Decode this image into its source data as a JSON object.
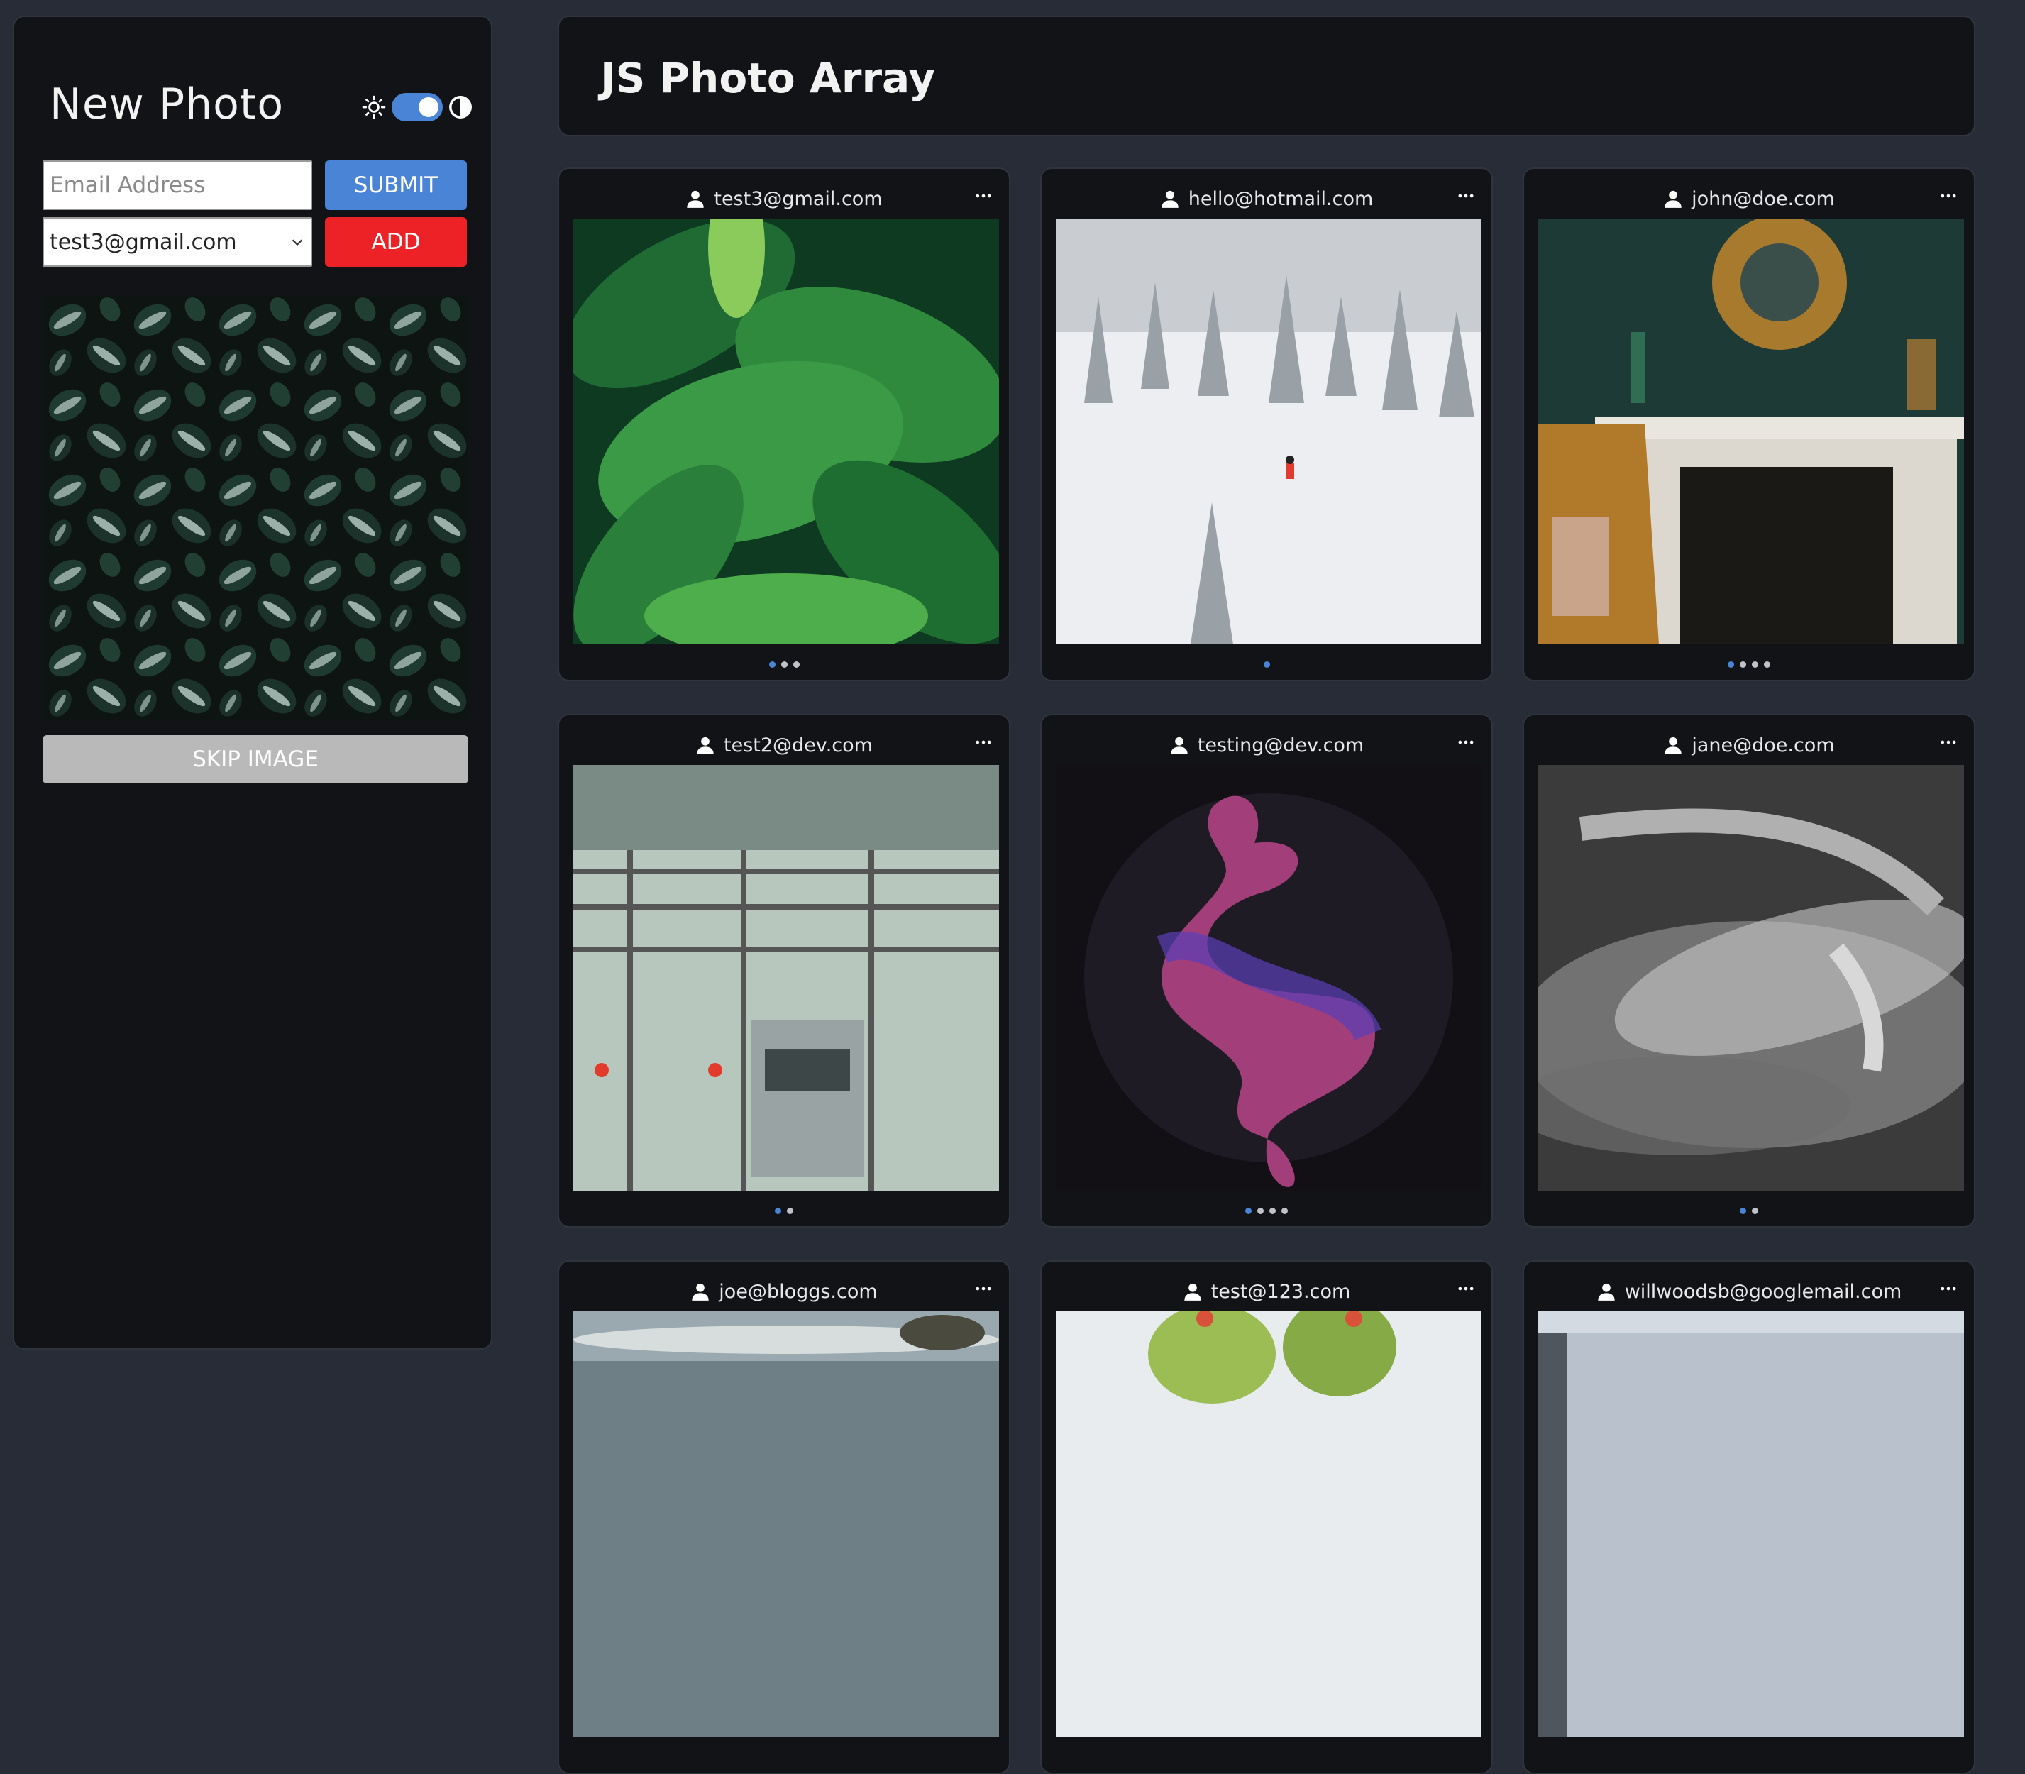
{
  "sidebar": {
    "title": "New Photo",
    "email_placeholder": "Email Address",
    "submit_label": "SUBMIT",
    "selected_email": "test3@gmail.com",
    "add_label": "ADD",
    "skip_label": "SKIP IMAGE",
    "theme_toggle_on": true
  },
  "header": {
    "title": "JS Photo Array"
  },
  "cards": [
    {
      "email": "test3@gmail.com",
      "dots": 3,
      "active": 0
    },
    {
      "email": "hello@hotmail.com",
      "dots": 1,
      "active": 0
    },
    {
      "email": "john@doe.com",
      "dots": 4,
      "active": 0
    },
    {
      "email": "test2@dev.com",
      "dots": 2,
      "active": 0
    },
    {
      "email": "testing@dev.com",
      "dots": 4,
      "active": 0
    },
    {
      "email": "jane@doe.com",
      "dots": 2,
      "active": 0
    },
    {
      "email": "joe@bloggs.com"
    },
    {
      "email": "test@123.com"
    },
    {
      "email": "willwoodsb@googlemail.com"
    }
  ],
  "colors": {
    "accent": "#4a84d6",
    "danger": "#ec2226",
    "skip": "#b9b9b9",
    "panel": "#111317",
    "background": "#272c36"
  }
}
